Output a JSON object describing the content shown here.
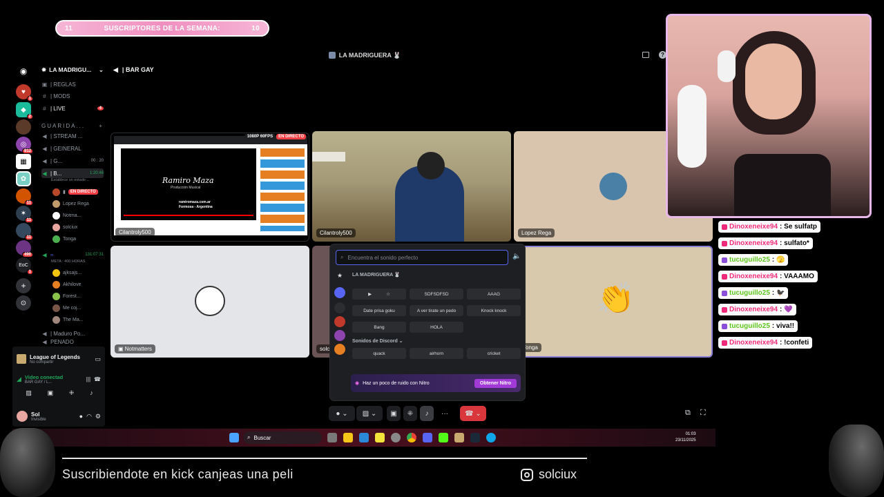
{
  "overlay": {
    "sub_left": "11",
    "sub_title": "SUSCRIPTORES DE LA SEMANA:",
    "sub_right": "10",
    "bottom_text": "Suscribiendote en kick canjeas una peli",
    "handle": "solciux"
  },
  "discord": {
    "window_title": "LA MADRIGUERA 🐰",
    "server_name": "LA MADRIGU...",
    "voice_channel": "| BAR GAY",
    "channels": [
      {
        "label": "| REGLAS",
        "icon": "#"
      },
      {
        "label": "| MODS",
        "icon": "#"
      },
      {
        "label": "| LIVE",
        "icon": "#"
      },
      {
        "label": "GUARIDA...",
        "icon": ""
      },
      {
        "label": "| STREAM ...",
        "icon": "🔊"
      },
      {
        "label": "| GEINERAL",
        "icon": "🔊"
      },
      {
        "label": "| G...",
        "icon": "🔊"
      },
      {
        "label": "| B...",
        "icon": "🔊"
      }
    ],
    "channel_badges": {
      "g_count": "00 : 20",
      "b_time": "1:20:46",
      "b_status": "Establece un estado ..."
    },
    "voice_users": [
      {
        "name": "EN DIRECTO"
      },
      {
        "name": "Lopez Rega"
      },
      {
        "name": "Notma..."
      },
      {
        "name": "solciux"
      },
      {
        "name": "Tonga"
      }
    ],
    "meta_channel": {
      "time": "131:07:31",
      "goal": "META : 400 HORAS"
    },
    "meta_users": [
      {
        "name": "ajksajs..."
      },
      {
        "name": "Akhilove"
      },
      {
        "name": "Forest..."
      },
      {
        "name": "Me coj..."
      },
      {
        "name": "The Ma..."
      }
    ],
    "other_channels": [
      "| Maduro Po...",
      "PENADO"
    ],
    "activity": {
      "game": "League of Legends",
      "sub": "No compartir"
    },
    "voice_panel": {
      "status": "Video conectad",
      "channel": "BAR GAY / L..."
    },
    "me": {
      "name": "Sol",
      "status": "Invisible"
    },
    "server_badges": [
      "1",
      "2",
      "812",
      "11",
      "11",
      "11",
      "490",
      "1"
    ],
    "tiles": [
      {
        "name": "Cilantroly500",
        "badge_quality": "1080P 60FPS",
        "badge_live": "EN DIRECTO",
        "inner_title": "Ramiro Maza",
        "inner_sub": "Producción Musical",
        "inner_url": "ramiromaza.com.ar",
        "inner_loc": "Formosa - Argentina"
      },
      {
        "name": "Cilantroly500"
      },
      {
        "name": "Lopez Rega"
      },
      {
        "name": "Notmatters"
      },
      {
        "name": "solci"
      },
      {
        "name": "Tonga"
      }
    ],
    "soundboard": {
      "search_placeholder": "Encuentra el sonido perfecto",
      "server_label": "LA MADRIGUERA 🐰",
      "sounds": [
        "SDFSDFSD",
        "AAAG",
        "Date prisa goku",
        "A ver tirate un pedo",
        "Knock knock",
        "Bang",
        "HOLA"
      ],
      "discord_section": "Sonidos de Discord",
      "discord_sounds": [
        "quack",
        "airhorn",
        "cricket"
      ],
      "nitro_text": "Haz un poco de ruido con Nitro",
      "nitro_button": "Obtener Nitro"
    }
  },
  "taskbar": {
    "search": "Buscar",
    "time": "01:03",
    "date": "23/11/2025"
  },
  "chat": [
    {
      "user": "Dinoxeneixe94",
      "msg": ": Se sulfatp",
      "color": "pink"
    },
    {
      "user": "Dinoxeneixe94",
      "msg": ": sulfato*",
      "color": "pink"
    },
    {
      "user": "tucuguillo25",
      "msg": ": 🫣",
      "color": "green"
    },
    {
      "user": "Dinoxeneixe94",
      "msg": ": VAAAMO",
      "color": "pink"
    },
    {
      "user": "tucuguillo25",
      "msg": ": 🐦‍⬛",
      "color": "green"
    },
    {
      "user": "Dinoxeneixe94",
      "msg": ": 💜",
      "color": "pink"
    },
    {
      "user": "tucuguillo25",
      "msg": ": viva!!",
      "color": "green"
    },
    {
      "user": "Dinoxeneixe94",
      "msg": ": !confeti",
      "color": "pink"
    }
  ]
}
